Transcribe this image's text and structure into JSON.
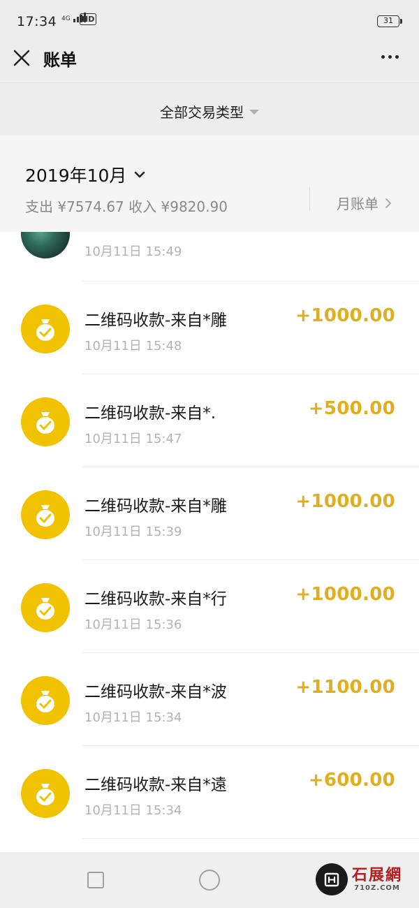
{
  "status_bar": {
    "time": "17:34",
    "network": "4G",
    "hd": "HD",
    "battery": "31"
  },
  "nav": {
    "title": "账单"
  },
  "filter": {
    "label": "全部交易类型"
  },
  "month": {
    "label": "2019年10月",
    "summary": "支出 ¥7574.67 收入 ¥9820.90",
    "monthly_bill_label": "月账单"
  },
  "partial_item": {
    "time": "10月11日 15:49"
  },
  "transactions": [
    {
      "title": "二维码收款-来自*雕",
      "time": "10月11日 15:48",
      "amount": "+1000.00"
    },
    {
      "title": "二维码收款-来自*.",
      "time": "10月11日 15:47",
      "amount": "+500.00"
    },
    {
      "title": "二维码收款-来自*雕",
      "time": "10月11日 15:39",
      "amount": "+1000.00"
    },
    {
      "title": "二维码收款-来自*行",
      "time": "10月11日 15:36",
      "amount": "+1000.00"
    },
    {
      "title": "二维码收款-来自*波",
      "time": "10月11日 15:34",
      "amount": "+1100.00"
    },
    {
      "title": "二维码收款-来自*遠",
      "time": "10月11日 15:34",
      "amount": "+600.00"
    }
  ],
  "watermark": {
    "name": "石展網",
    "site": "710Z.COM"
  },
  "colors": {
    "accent_gold": "#e0ae1e",
    "icon_yellow": "#f0c200",
    "header_gray": "#ededed"
  },
  "icons": [
    "close-icon",
    "more-icon",
    "chevron-down-icon",
    "chevron-right-icon",
    "money-bag-icon"
  ]
}
